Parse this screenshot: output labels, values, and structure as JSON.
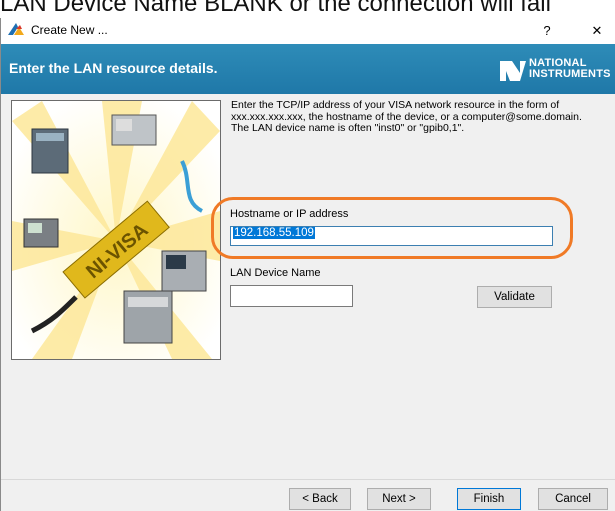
{
  "background_caption": "LAN Device Name BLANK or the connection will fail",
  "window": {
    "title": "Create New ...",
    "help_button": "?",
    "close_button": "✕"
  },
  "header": {
    "heading": "Enter the LAN resource details.",
    "logo_line1": "NATIONAL",
    "logo_line2": "INSTRUMENTS"
  },
  "illustration": {
    "product_label": "NI-VISA"
  },
  "form": {
    "description": "Enter the TCP/IP address of your VISA network resource in the form of xxx.xxx.xxx.xxx, the hostname of the device, or a computer@some.domain. The LAN device name is often \"inst0\" or \"gpib0,1\".",
    "hostname_label": "Hostname or IP address",
    "hostname_value": "192.168.55.109",
    "lan_device_label": "LAN Device Name",
    "lan_device_value": "",
    "validate_label": "Validate"
  },
  "footer": {
    "back_label": "< Back",
    "next_label": "Next >",
    "finish_label": "Finish",
    "cancel_label": "Cancel"
  },
  "colors": {
    "header_blue": "#2486b8",
    "highlight_orange": "#f07a26",
    "selection_blue": "#0078d7"
  }
}
